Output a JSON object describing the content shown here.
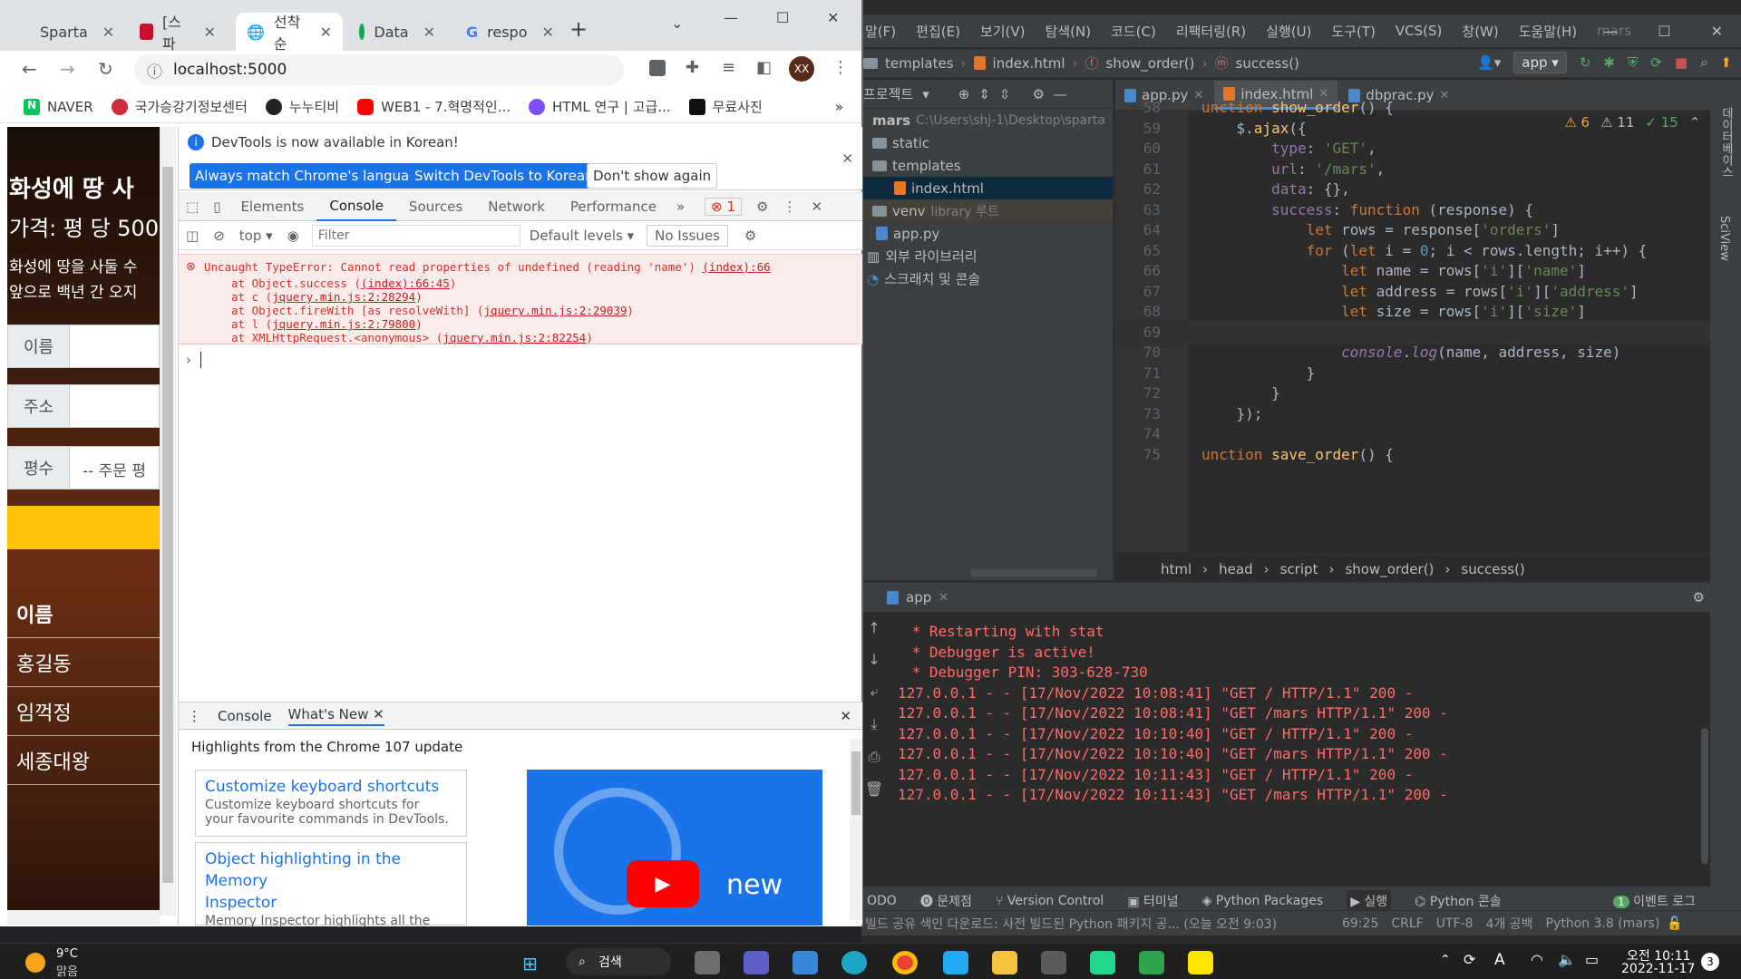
{
  "ide": {
    "menu": [
      "말(F)",
      "편집(E)",
      "보기(V)",
      "탐색(N)",
      "코드(C)",
      "리팩터링(R)",
      "실행(U)",
      "도구(T)",
      "VCS(S)",
      "창(W)",
      "도움말(H)",
      "mars"
    ],
    "nav": {
      "folder": "templates",
      "file": "index.html",
      "fn1": "show_order()",
      "fn2": "success()",
      "run_config": "app"
    },
    "project": {
      "title": "프로젝트",
      "root": "mars",
      "root_path": "C:\\Users\\shj-1\\Desktop\\sparta",
      "items": [
        "static",
        "templates",
        "index.html",
        "venv",
        "library 루트",
        "app.py",
        "외부 라이브러리",
        "스크래치 및 콘솔"
      ]
    },
    "tabs": [
      "app.py",
      "index.html",
      "dbprac.py"
    ],
    "inspect": {
      "warn1": "6",
      "warn2": "11",
      "ok": "15"
    },
    "code": [
      {
        "n": "58",
        "t": "unction show_order() {"
      },
      {
        "n": "59",
        "t": "    $.ajax({"
      },
      {
        "n": "60",
        "t": "        type: 'GET',"
      },
      {
        "n": "61",
        "t": "        url: '/mars',"
      },
      {
        "n": "62",
        "t": "        data: {},"
      },
      {
        "n": "63",
        "t": "        success: function (response) {"
      },
      {
        "n": "64",
        "t": "            let rows = response['orders']"
      },
      {
        "n": "65",
        "t": "            for (let i = 0; i < rows.length; i++) {"
      },
      {
        "n": "66",
        "t": "                let name = rows['i']['name']"
      },
      {
        "n": "67",
        "t": "                let address = rows['i']['address']"
      },
      {
        "n": "68",
        "t": "                let size = rows['i']['size']"
      },
      {
        "n": "69",
        "t": ""
      },
      {
        "n": "70",
        "t": "                console.log(name, address, size)"
      },
      {
        "n": "71",
        "t": "            }"
      },
      {
        "n": "72",
        "t": "        }"
      },
      {
        "n": "73",
        "t": "    });"
      },
      {
        "n": "74",
        "t": ""
      },
      {
        "n": "75",
        "t": "unction save_order() {"
      }
    ],
    "breadcrumb": [
      "html",
      "head",
      "script",
      "show_order()",
      "success()"
    ],
    "run": {
      "tab": "app",
      "lines": [
        " * Restarting with stat",
        " * Debugger is active!",
        " * Debugger PIN: 303-628-730",
        "127.0.0.1 - - [17/Nov/2022 10:08:41] \"GET / HTTP/1.1\" 200 -",
        "127.0.0.1 - - [17/Nov/2022 10:08:41] \"GET /mars HTTP/1.1\" 200 -",
        "127.0.0.1 - - [17/Nov/2022 10:10:40] \"GET / HTTP/1.1\" 200 -",
        "127.0.0.1 - - [17/Nov/2022 10:10:40] \"GET /mars HTTP/1.1\" 200 -",
        "127.0.0.1 - - [17/Nov/2022 10:11:43] \"GET / HTTP/1.1\" 200 -",
        "127.0.0.1 - - [17/Nov/2022 10:11:43] \"GET /mars HTTP/1.1\" 200 -"
      ]
    },
    "toolwindows": [
      "ODO",
      "문제점",
      "Version Control",
      "터미널",
      "Python Packages",
      "실행",
      "Python 콘솔",
      "이벤트 로그"
    ],
    "event_count": "1",
    "status": {
      "msg": "빌드 공유 색인 다운로드: 사전 빌드된 Python 패키지 공... (오늘 오전 9:03)",
      "pos": "69:25",
      "crlf": "CRLF",
      "enc": "UTF-8",
      "indent": "4개 공백",
      "interp": "Python 3.8 (mars)"
    },
    "side_labels": [
      "데이터베이스",
      "SciView"
    ]
  },
  "chrome": {
    "tabs": [
      "Sparta",
      "[스파",
      "선착순",
      "Data",
      "respo"
    ],
    "url": "localhost:5000",
    "profile": "XX",
    "bookmarks": [
      "NAVER",
      "국가승강기정보센터",
      "누누티비",
      "WEB1 - 7.혁명적인...",
      "HTML 연구 | 고급...",
      "무료사진"
    ]
  },
  "page": {
    "heading": "화성에 땅 사",
    "price": "가격: 평 당 500",
    "desc1": "화성에 땅을 사둘 수",
    "desc2": "앞으로 백년 간 오지",
    "name_label": "이름",
    "address_label": "주소",
    "size_label": "평수",
    "size_placeholder": "-- 주문 평",
    "table_header": "이름",
    "rows": [
      "홍길동",
      "임꺽정",
      "세종대왕"
    ]
  },
  "devtools": {
    "info": "DevTools is now available in Korean!",
    "btn_match": "Always match Chrome's language",
    "btn_switch": "Switch DevTools to Korean",
    "btn_dont": "Don't show again",
    "tabs": [
      "Elements",
      "Console",
      "Sources",
      "Network",
      "Performance"
    ],
    "error_count": "1",
    "context": "top",
    "filter_placeholder": "Filter",
    "levels": "Default levels",
    "issues": "No Issues",
    "error": {
      "message": "Uncaught TypeError: Cannot read properties of undefined (reading 'name')",
      "source": "(index):66",
      "stack": [
        {
          "text": "at Object.success (",
          "link": "(index):66:45",
          "end": ")"
        },
        {
          "text": "at c (",
          "link": "jquery.min.js:2:28294",
          "end": ")"
        },
        {
          "text": "at Object.fireWith [as resolveWith] (",
          "link": "jquery.min.js:2:29039",
          "end": ")"
        },
        {
          "text": "at l (",
          "link": "jquery.min.js:2:79800",
          "end": ")"
        },
        {
          "text": "at XMLHttpRequest.<anonymous> (",
          "link": "jquery.min.js:2:82254",
          "end": ")"
        }
      ]
    },
    "drawer_tabs": [
      "Console",
      "What's New"
    ],
    "highlights": "Highlights from the Chrome 107 update",
    "card1_title": "Customize keyboard shortcuts",
    "card1_desc1": "Customize keyboard shortcuts for",
    "card1_desc2": "your favourite commands in DevTools.",
    "card2_title1": "Object highlighting in the Memory",
    "card2_title2": "Inspector",
    "card2_desc": "Memory Inspector highlights all the",
    "video_label": "new"
  },
  "taskbar": {
    "temp": "9°C",
    "weather": "맑음",
    "search": "검색",
    "time": "오전 10:11",
    "date": "2022-11-17",
    "badge": "3",
    "ime": "A"
  }
}
